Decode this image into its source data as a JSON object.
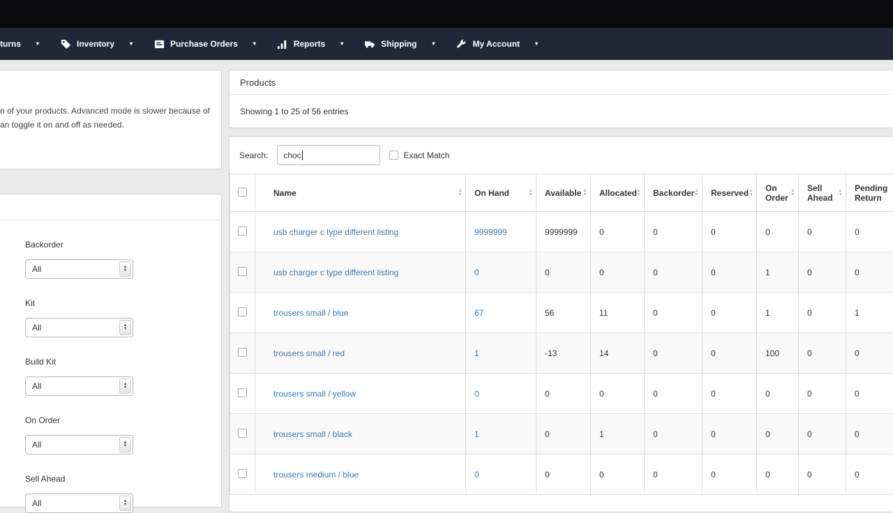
{
  "colors": {
    "topbar_background": "#0a0a0c",
    "nav_background": "#232639",
    "link": "#337ab7",
    "page_background": "#eaeaea"
  },
  "nav": {
    "items": [
      {
        "label": "turns"
      },
      {
        "label": "Inventory"
      },
      {
        "label": "Purchase Orders"
      },
      {
        "label": "Reports"
      },
      {
        "label": "Shipping"
      },
      {
        "label": "My Account"
      }
    ]
  },
  "sidebar": {
    "info_lines": [
      "n of your products. Advanced mode is slower because of",
      "an toggle it on and off as needed."
    ],
    "filters": [
      {
        "label": "Backorder",
        "value": "All"
      },
      {
        "label": "Kit",
        "value": "All"
      },
      {
        "label": "Build Kit",
        "value": "All"
      },
      {
        "label": "On Order",
        "value": "All"
      },
      {
        "label": "Sell Ahead",
        "value": "All"
      }
    ]
  },
  "main": {
    "panel_title": "Products",
    "entries_info": "Showing 1 to 25 of 56 entries",
    "search": {
      "label": "Search:",
      "value": "choc",
      "exact_match_label": "Exact Match",
      "exact_match_checked": false
    },
    "table": {
      "columns": [
        "Name",
        "On Hand",
        "Available",
        "Allocated",
        "Backorder",
        "Reserved",
        "On Order",
        "Sell Ahead",
        "Pending Return"
      ],
      "rows": [
        {
          "name": "usb charger c type different listing",
          "on_hand": "9999999",
          "available": "9999999",
          "allocated": "0",
          "backorder": "0",
          "reserved": "0",
          "on_order": "0",
          "sell_ahead": "0",
          "pending_return": "0"
        },
        {
          "name": "usb charger c type different listing",
          "on_hand": "0",
          "available": "0",
          "allocated": "0",
          "backorder": "0",
          "reserved": "0",
          "on_order": "1",
          "sell_ahead": "0",
          "pending_return": "0"
        },
        {
          "name": "trousers small / blue",
          "on_hand": "67",
          "available": "56",
          "allocated": "11",
          "backorder": "0",
          "reserved": "0",
          "on_order": "1",
          "sell_ahead": "0",
          "pending_return": "1"
        },
        {
          "name": "trousers small / red",
          "on_hand": "1",
          "available": "-13",
          "allocated": "14",
          "backorder": "0",
          "reserved": "0",
          "on_order": "100",
          "sell_ahead": "0",
          "pending_return": "0"
        },
        {
          "name": "trousers small / yellow",
          "on_hand": "0",
          "available": "0",
          "allocated": "0",
          "backorder": "0",
          "reserved": "0",
          "on_order": "0",
          "sell_ahead": "0",
          "pending_return": "0"
        },
        {
          "name": "trousers small / black",
          "on_hand": "1",
          "available": "0",
          "allocated": "1",
          "backorder": "0",
          "reserved": "0",
          "on_order": "0",
          "sell_ahead": "0",
          "pending_return": "0"
        },
        {
          "name": "trousers medium / blue",
          "on_hand": "0",
          "available": "0",
          "allocated": "0",
          "backorder": "0",
          "reserved": "0",
          "on_order": "0",
          "sell_ahead": "0",
          "pending_return": "0"
        }
      ]
    }
  }
}
